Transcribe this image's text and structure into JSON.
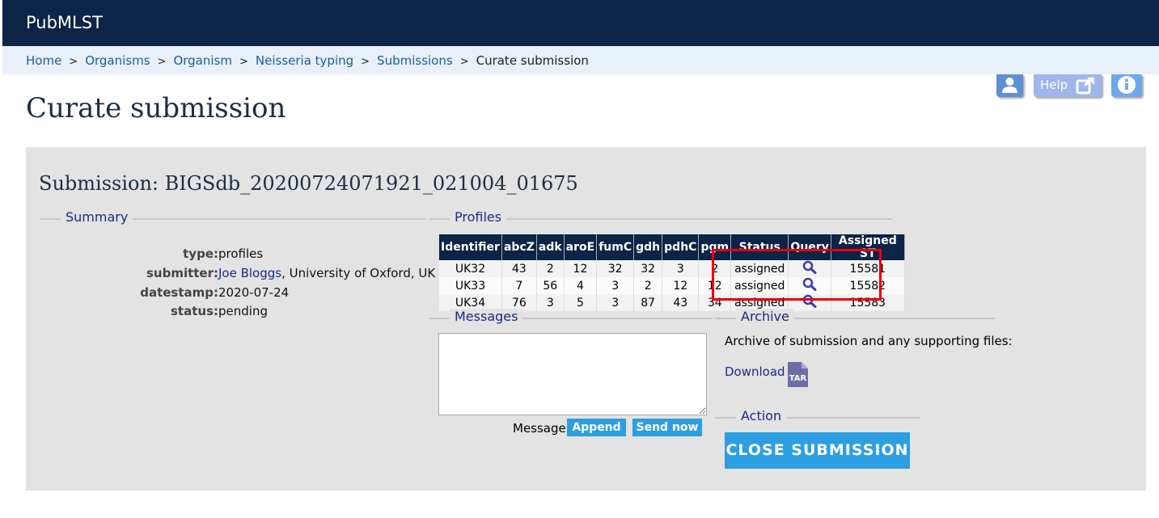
{
  "header": {
    "brand": "PubMLST"
  },
  "breadcrumb": {
    "items": [
      "Home",
      "Organisms",
      "Organism",
      "Neisseria typing",
      "Submissions"
    ],
    "current": "Curate submission",
    "separator": ">"
  },
  "toolbar": {
    "help_label": "Help"
  },
  "page": {
    "title": "Curate submission"
  },
  "submission": {
    "heading": "Submission: BIGSdb_20200724071921_021004_01675"
  },
  "summary": {
    "legend": "Summary",
    "fields": [
      {
        "key": "type:",
        "value": "profiles"
      },
      {
        "key": "submitter:",
        "link": "Joe Bloggs",
        "value": ", University of Oxford, UK"
      },
      {
        "key": "datestamp:",
        "value": "2020-07-24"
      },
      {
        "key": "status:",
        "value": "pending"
      }
    ]
  },
  "profiles": {
    "legend": "Profiles",
    "columns": [
      "Identifier",
      "abcZ",
      "adk",
      "aroE",
      "fumC",
      "gdh",
      "pdhC",
      "pgm",
      "Status",
      "Query",
      "Assigned ST"
    ],
    "rows": [
      {
        "id": "UK32",
        "abcZ": "43",
        "adk": "2",
        "aroE": "12",
        "fumC": "32",
        "gdh": "32",
        "pdhC": "3",
        "pgm": "2",
        "status": "assigned",
        "st": "15581"
      },
      {
        "id": "UK33",
        "abcZ": "7",
        "adk": "56",
        "aroE": "4",
        "fumC": "3",
        "gdh": "2",
        "pdhC": "12",
        "pgm": "12",
        "status": "assigned",
        "st": "15582"
      },
      {
        "id": "UK34",
        "abcZ": "76",
        "adk": "3",
        "aroE": "5",
        "fumC": "3",
        "gdh": "87",
        "pdhC": "43",
        "pgm": "34",
        "status": "assigned",
        "st": "15583"
      }
    ]
  },
  "messages": {
    "legend": "Messages",
    "textarea_value": "",
    "label": "Message:",
    "append_label": "Append",
    "send_label": "Send now"
  },
  "archive": {
    "legend": "Archive",
    "text": "Archive of submission and any supporting files:",
    "download_label": "Download",
    "file_badge": "TAR"
  },
  "action": {
    "legend": "Action",
    "close_label": "CLOSE SUBMISSION"
  },
  "colors": {
    "header_bg": "#0b2447",
    "breadcrumb_bg": "#e8f0fa",
    "button_blue": "#2d9ee0",
    "highlight_red": "#e8000d",
    "panel_bg": "#e3e3e3"
  }
}
